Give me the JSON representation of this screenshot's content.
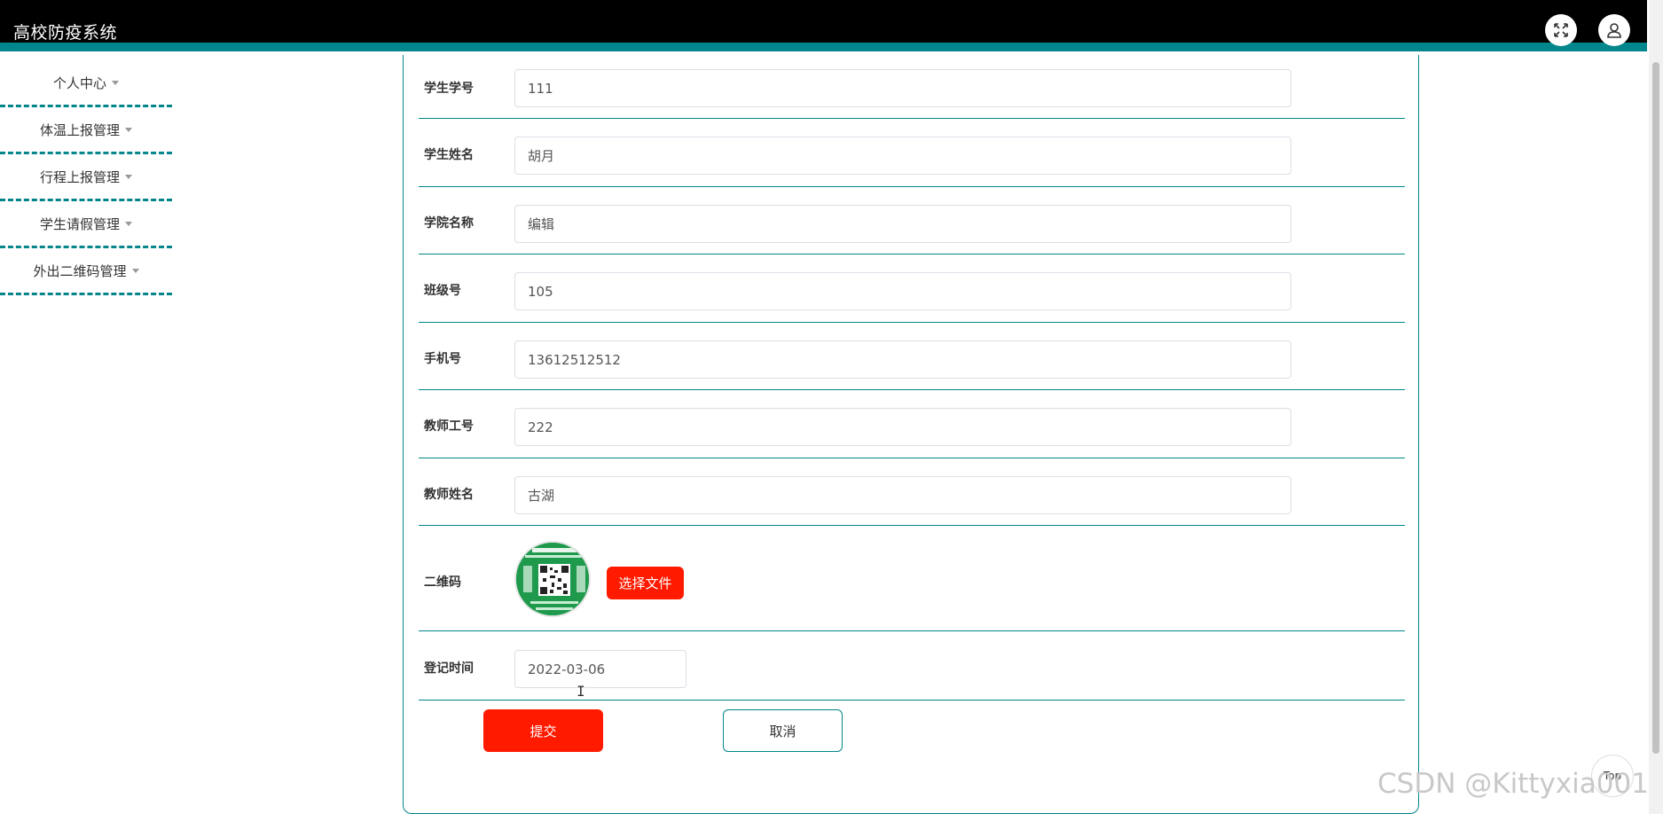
{
  "app": {
    "title": "高校防疫系统"
  },
  "header": {
    "fullscreen_icon": "expand-icon",
    "user_icon": "user-icon"
  },
  "sidebar": {
    "items": [
      {
        "label": "个人中心"
      },
      {
        "label": "体温上报管理"
      },
      {
        "label": "行程上报管理"
      },
      {
        "label": "学生请假管理"
      },
      {
        "label": "外出二维码管理"
      }
    ]
  },
  "form": {
    "student_id": {
      "label": "学生学号",
      "value": "111"
    },
    "student_name": {
      "label": "学生姓名",
      "value": "胡月"
    },
    "college": {
      "label": "学院名称",
      "value": "编辑"
    },
    "class_no": {
      "label": "班级号",
      "value": "105"
    },
    "phone": {
      "label": "手机号",
      "value": "13612512512"
    },
    "teacher_id": {
      "label": "教师工号",
      "value": "222"
    },
    "teacher_name": {
      "label": "教师姓名",
      "value": "古湖"
    },
    "qrcode": {
      "label": "二维码",
      "choose_file": "选择文件"
    },
    "register_time": {
      "label": "登记时间",
      "value": "2022-03-06"
    },
    "submit": "提交",
    "cancel": "取消"
  },
  "to_top": "Top",
  "watermark": "CSDN @Kittyxia001",
  "colors": {
    "accent": "#00868b",
    "primary_button": "#ff1a00",
    "header": "#000000"
  }
}
